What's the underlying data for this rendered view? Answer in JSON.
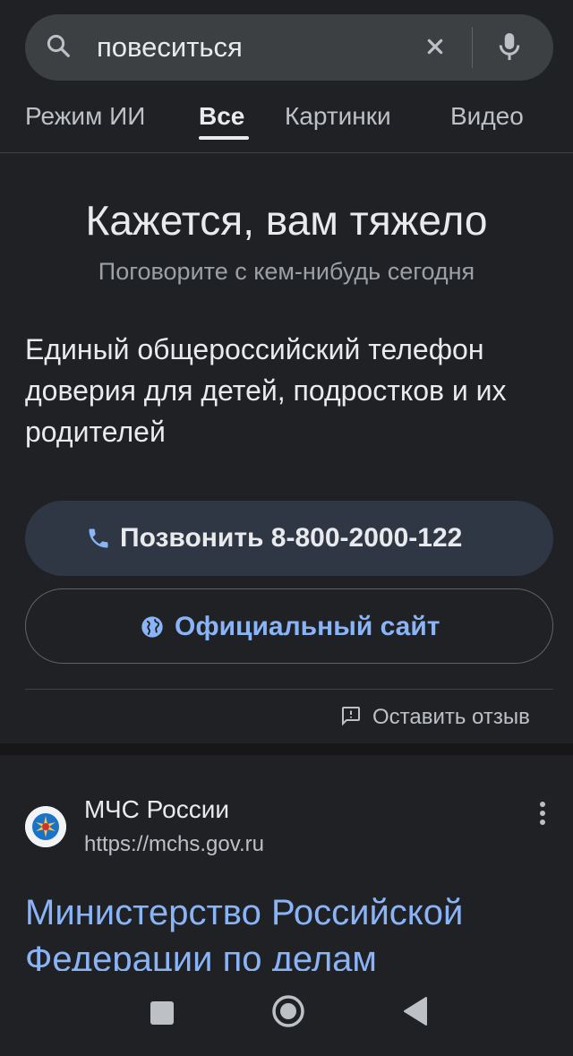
{
  "search": {
    "query": "повеситься"
  },
  "tabs": [
    {
      "label": "Режим ИИ"
    },
    {
      "label": "Все"
    },
    {
      "label": "Картинки"
    },
    {
      "label": "Видео"
    }
  ],
  "crisis_card": {
    "title": "Кажется, вам тяжело",
    "subtitle": "Поговорите с кем-нибудь сегодня",
    "description": "Единый общероссийский телефон доверия для детей, подростков и их родителей",
    "call_label": "Позвонить 8-800-2000-122",
    "site_label": "Официальный сайт",
    "feedback_label": "Оставить отзыв"
  },
  "result": {
    "site_name": "МЧС России",
    "url": "https://mchs.gov.ru",
    "title": "Министерство Российской Федерации по делам"
  },
  "colors": {
    "background": "#202124",
    "search_bar": "#3c4043",
    "call_button": "#303744",
    "link_blue": "#8ab4f8"
  },
  "icons": [
    "search-icon",
    "clear-icon",
    "mic-icon",
    "phone-icon",
    "globe-icon",
    "feedback-icon",
    "more-vert-icon",
    "nav-recents-icon",
    "nav-home-icon",
    "nav-back-icon"
  ]
}
